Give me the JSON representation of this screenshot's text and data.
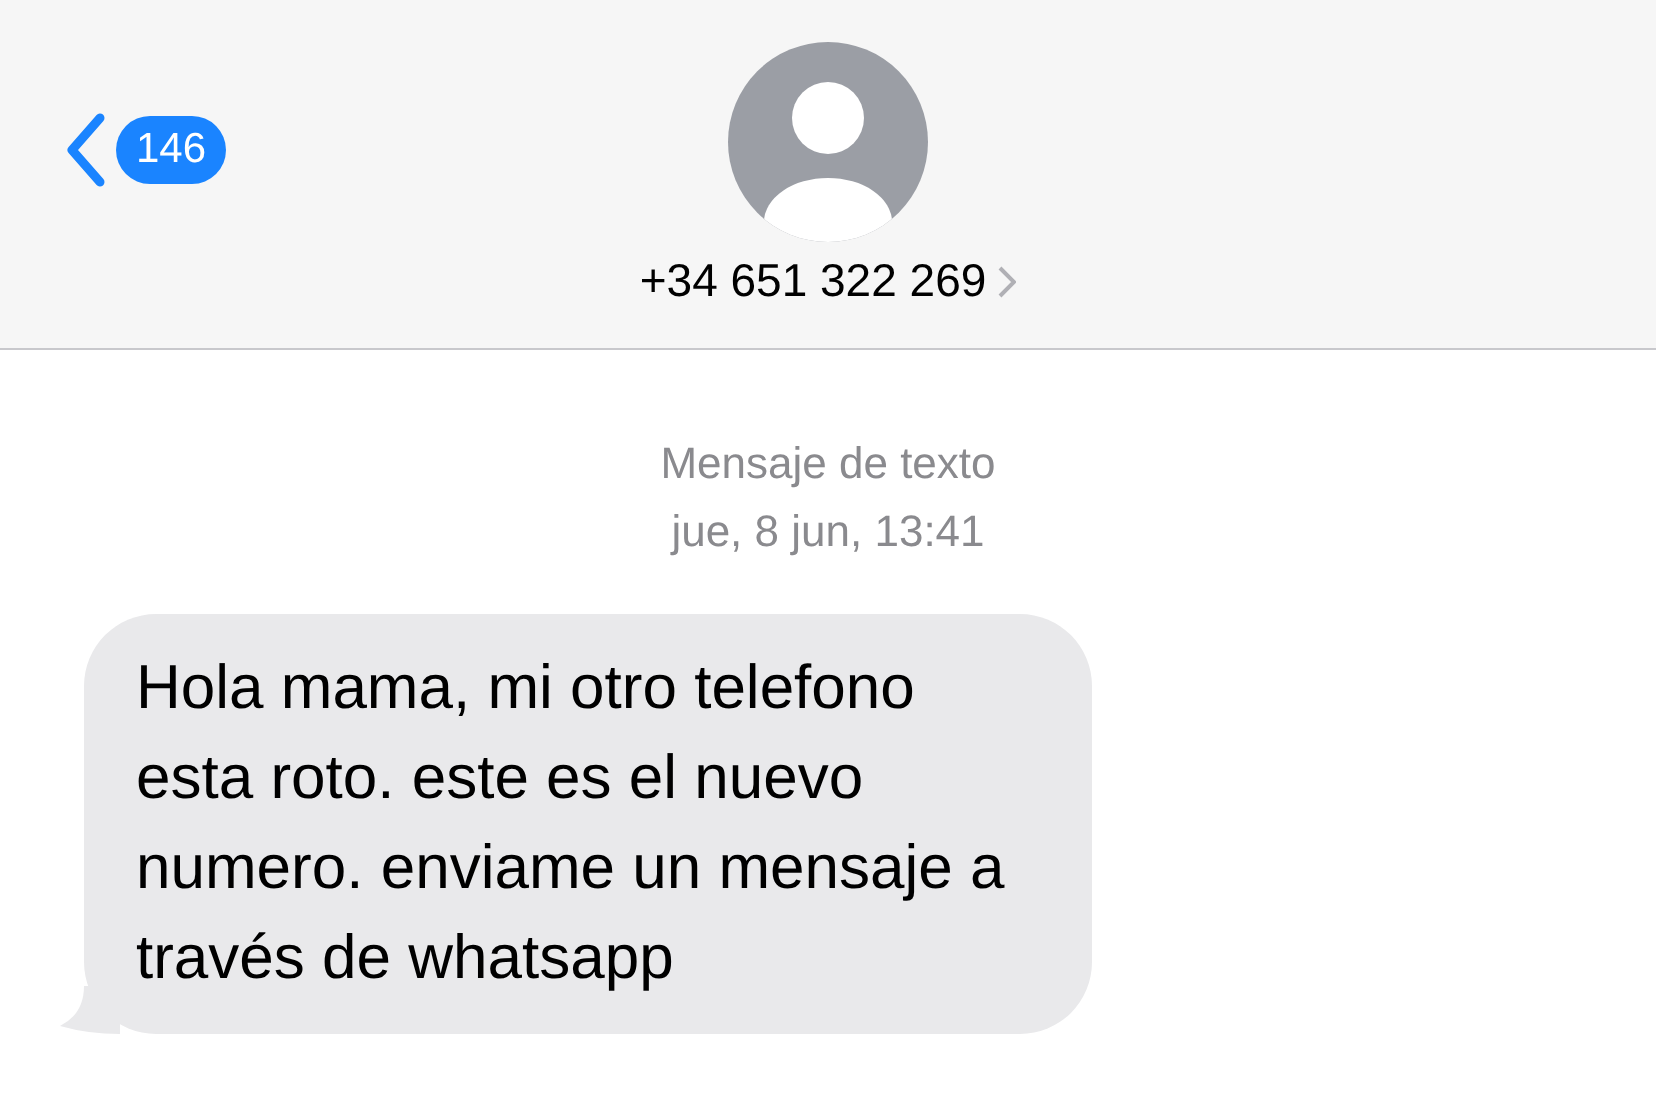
{
  "header": {
    "back_count": "146",
    "contact": "+34 651 322 269"
  },
  "thread": {
    "service": "Mensaje de texto",
    "timestamp": "jue, 8 jun, 13:41",
    "messages": [
      {
        "kind": "received",
        "text": "Hola mama, mi otro telefono esta roto. este es el nuevo numero. enviame un mensaje a través de whatsapp"
      }
    ]
  }
}
